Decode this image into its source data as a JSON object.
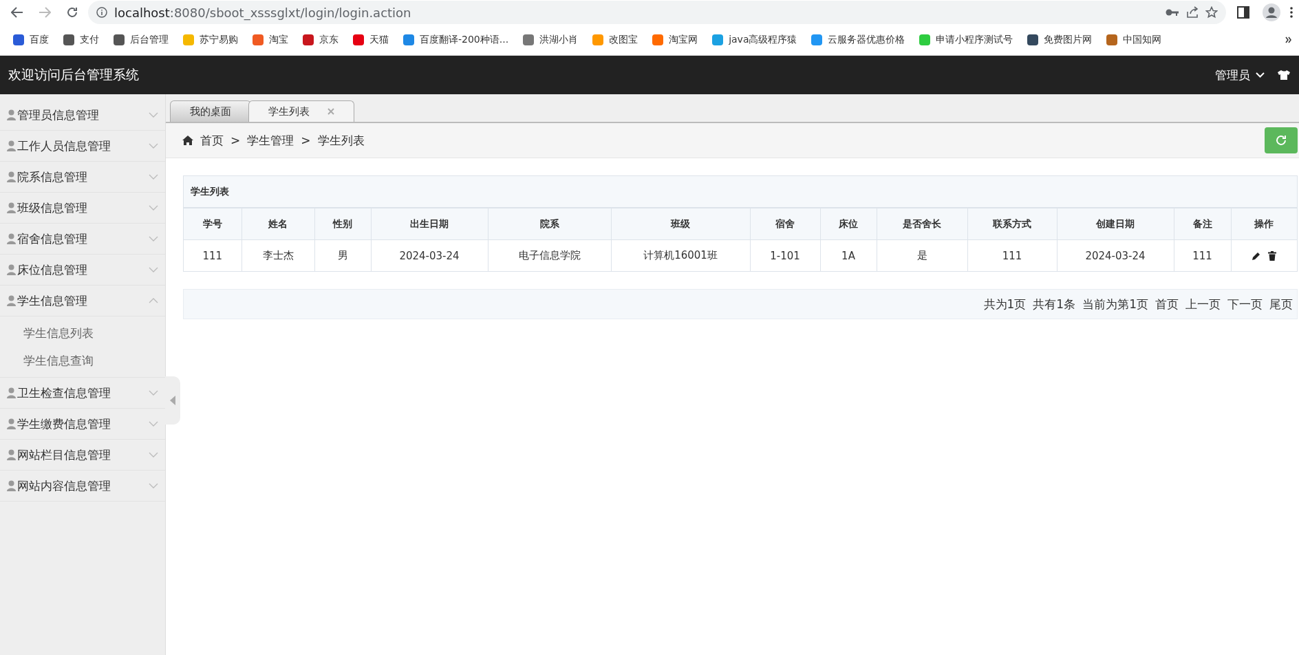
{
  "browser": {
    "url_host": "localhost",
    "url_rest": ":8080/sboot_xsssglxt/login/login.action",
    "bookmarks": [
      "百度",
      "支付",
      "后台管理",
      "苏宁易购",
      "淘宝",
      "京东",
      "天猫",
      "百度翻译-200种语...",
      "洪湖小肖",
      "改图宝",
      "淘宝网",
      "java高级程序猿",
      "云服务器优惠价格",
      "申请小程序测试号",
      "免费图片网",
      "中国知网"
    ]
  },
  "header": {
    "title": "欢迎访问后台管理系统",
    "user": "管理员"
  },
  "sidebar": {
    "items": [
      {
        "label": "管理员信息管理",
        "expanded": false
      },
      {
        "label": "工作人员信息管理",
        "expanded": false
      },
      {
        "label": "院系信息管理",
        "expanded": false
      },
      {
        "label": "班级信息管理",
        "expanded": false
      },
      {
        "label": "宿舍信息管理",
        "expanded": false
      },
      {
        "label": "床位信息管理",
        "expanded": false
      },
      {
        "label": "学生信息管理",
        "expanded": true,
        "children": [
          {
            "label": "学生信息列表"
          },
          {
            "label": "学生信息查询"
          }
        ]
      },
      {
        "label": "卫生检查信息管理",
        "expanded": false
      },
      {
        "label": "学生缴费信息管理",
        "expanded": false
      },
      {
        "label": "网站栏目信息管理",
        "expanded": false
      },
      {
        "label": "网站内容信息管理",
        "expanded": false
      }
    ]
  },
  "tabs": [
    {
      "label": "我的桌面",
      "selected": false
    },
    {
      "label": "学生列表",
      "selected": true
    }
  ],
  "breadcrumb": {
    "separator": ">",
    "items": [
      "首页",
      "学生管理",
      "学生列表"
    ]
  },
  "table": {
    "title": "学生列表",
    "columns": [
      "学号",
      "姓名",
      "性别",
      "出生日期",
      "院系",
      "班级",
      "宿舍",
      "床位",
      "是否舍长",
      "联系方式",
      "创建日期",
      "备注",
      "操作"
    ],
    "rows": [
      [
        "111",
        "李士杰",
        "男",
        "2024-03-24",
        "电子信息学院",
        "计算机16001班",
        "1-101",
        "1A",
        "是",
        "111",
        "2024-03-24",
        "111"
      ]
    ]
  },
  "pager": [
    "共为1页",
    "共有1条",
    "当前为第1页",
    "首页",
    "上一页",
    "下一页",
    "尾页"
  ]
}
